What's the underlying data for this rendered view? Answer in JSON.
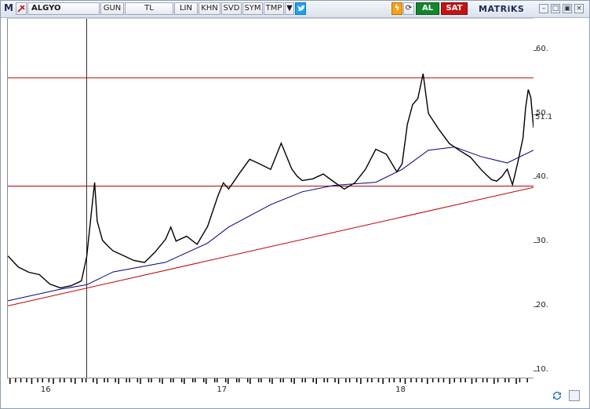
{
  "toolbar": {
    "logo": "M",
    "symbol": "ALGYO",
    "period": "GUN",
    "currency": "TL",
    "scale": "LIN",
    "khn": "KHN",
    "svd": "SVD",
    "sym": "SYM",
    "tmp": "TMP",
    "buy": "AL",
    "sell": "SAT",
    "brand": "MATRiKS",
    "colors": {
      "buy": "#14862c",
      "sell": "#c31414",
      "twitter": "#1da1f2"
    }
  },
  "chart_data": {
    "type": "line",
    "y_axis": {
      "ticks": [
        10,
        20,
        30,
        40,
        50,
        60
      ],
      "tick_labels": [
        "10.",
        "20.",
        "30.",
        "40.",
        "50.",
        "60."
      ],
      "range": [
        9,
        65
      ]
    },
    "x_axis": {
      "labels": [
        "16",
        "17",
        "18"
      ]
    },
    "last_value_label": "51.1",
    "horizontal_lines": [
      {
        "value": 55.8,
        "color": "#c00000"
      },
      {
        "value": 38.9,
        "color": "#c00000"
      }
    ],
    "trendline": {
      "from": {
        "x": 0,
        "y": 20.2
      },
      "to": {
        "x": 1,
        "y": 38.7
      },
      "color": "#c00000"
    },
    "cursor_line_x": 0.15,
    "series": [
      {
        "color": "#000000",
        "x": [
          0,
          0.02,
          0.04,
          0.06,
          0.08,
          0.1,
          0.12,
          0.14,
          0.15,
          0.16,
          0.165,
          0.17,
          0.18,
          0.19,
          0.2,
          0.22,
          0.24,
          0.26,
          0.28,
          0.3,
          0.31,
          0.32,
          0.34,
          0.36,
          0.38,
          0.4,
          0.41,
          0.42,
          0.43,
          0.44,
          0.46,
          0.48,
          0.5,
          0.52,
          0.54,
          0.55,
          0.56,
          0.58,
          0.6,
          0.62,
          0.64,
          0.66,
          0.68,
          0.7,
          0.72,
          0.74,
          0.75,
          0.76,
          0.77,
          0.78,
          0.79,
          0.8,
          0.81,
          0.82,
          0.84,
          0.86,
          0.88,
          0.9,
          0.91,
          0.92,
          0.93,
          0.94,
          0.95,
          0.96,
          0.97,
          0.98,
          0.985,
          0.99,
          0.995,
          1.0
        ],
        "y": [
          28,
          26,
          25,
          24.5,
          23,
          22.5,
          23,
          24,
          28,
          36,
          40,
          34,
          31,
          30,
          29,
          28,
          27,
          26.5,
          28,
          30,
          32,
          30,
          31,
          30,
          33,
          38,
          40,
          39,
          40,
          41,
          43,
          42,
          41,
          45,
          41,
          40,
          39.5,
          40,
          41,
          40,
          39,
          40,
          42,
          45,
          44,
          41,
          42,
          48,
          51,
          52,
          56,
          50,
          49,
          48,
          46,
          45,
          44,
          42,
          41,
          40,
          39.5,
          40,
          41,
          38.5,
          42,
          46,
          51,
          54,
          53,
          48
        ]
      },
      {
        "color": "#00007f",
        "x": [
          0,
          0.1,
          0.15,
          0.2,
          0.3,
          0.38,
          0.42,
          0.5,
          0.56,
          0.62,
          0.7,
          0.75,
          0.8,
          0.85,
          0.9,
          0.95,
          1.0
        ],
        "y": [
          21,
          22.8,
          23.5,
          25.5,
          27,
          30,
          32.5,
          36,
          38,
          39,
          39.5,
          41.5,
          44.5,
          45,
          43.5,
          42.5,
          44.5
        ]
      }
    ]
  }
}
